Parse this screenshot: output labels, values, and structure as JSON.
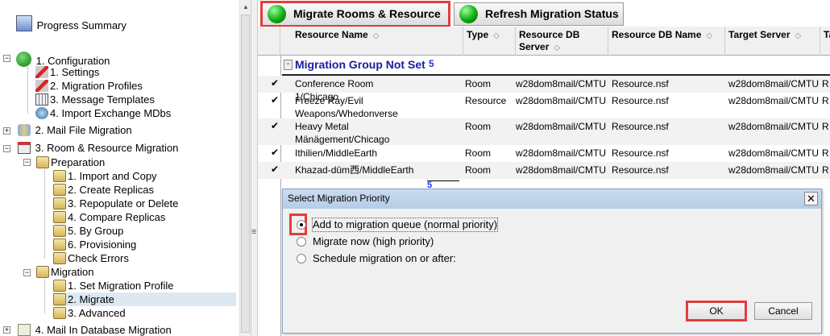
{
  "tree": {
    "progress_summary": "Progress Summary",
    "configuration": "1. Configuration",
    "settings": "1. Settings",
    "migration_profiles": "2. Migration Profiles",
    "message_templates": "3. Message Templates",
    "import_exchange": "4. Import Exchange MDbs",
    "mail_file_migration": "2. Mail File Migration",
    "room_resource_migration": "3. Room & Resource Migration",
    "preparation": "Preparation",
    "import_copy": "1. Import and Copy",
    "create_replicas": "2. Create Replicas",
    "repopulate": "3. Repopulate or Delete",
    "compare_replicas": "4. Compare Replicas",
    "by_group": "5. By Group",
    "provisioning": "6. Provisioning",
    "check_errors": "Check Errors",
    "migration": "Migration",
    "set_profile": "1. Set Migration Profile",
    "migrate": "2. Migrate",
    "advanced": "3. Advanced",
    "mail_in_db": "4. Mail In Database Migration"
  },
  "splitter_glyph": "≡",
  "toolbar": {
    "migrate_rooms": "Migrate Rooms & Resource",
    "refresh_status": "Refresh Migration Status"
  },
  "table": {
    "columns": [
      "Resource Name",
      "Type",
      "Resource DB Server",
      "Resource DB Name",
      "Target Server",
      "Ta"
    ],
    "sort_glyph": "◇",
    "group": {
      "label": "Migration Group Not Set",
      "count": "5",
      "toggle": "-"
    },
    "rows": [
      {
        "check": "✔",
        "name": "Conference Room 1/Chicago",
        "type": "Room",
        "server": "w28dom8mail/CMTU",
        "db": "Resource.nsf",
        "target": "w28dom8mail/CMTU",
        "t": "R"
      },
      {
        "check": "✔",
        "name": "Freeze Ray/Evil Weapons/Whedonverse",
        "type": "Resource",
        "server": "w28dom8mail/CMTU",
        "db": "Resource.nsf",
        "target": "w28dom8mail/CMTU",
        "t": "R"
      },
      {
        "check": "✔",
        "name": "Heavy Metal Mänägement/Chicago",
        "type": "Room",
        "server": "w28dom8mail/CMTU",
        "db": "Resource.nsf",
        "target": "w28dom8mail/CMTU",
        "t": "R"
      },
      {
        "check": "✔",
        "name": "Ithilien/MiddleEarth",
        "type": "Room",
        "server": "w28dom8mail/CMTU",
        "db": "Resource.nsf",
        "target": "w28dom8mail/CMTU",
        "t": "R"
      },
      {
        "check": "✔",
        "name": "Khazad-dûm西/MiddleEarth",
        "type": "Room",
        "server": "w28dom8mail/CMTU",
        "db": "Resource.nsf",
        "target": "w28dom8mail/CMTU",
        "t": "R"
      }
    ],
    "total": "5"
  },
  "dialog": {
    "title": "Select Migration Priority",
    "close": "✕",
    "options": [
      "Add to migration queue (normal priority)",
      "Migrate now (high priority)",
      "Schedule migration on or after:"
    ],
    "selected_index": 0,
    "ok": "OK",
    "cancel": "Cancel"
  }
}
